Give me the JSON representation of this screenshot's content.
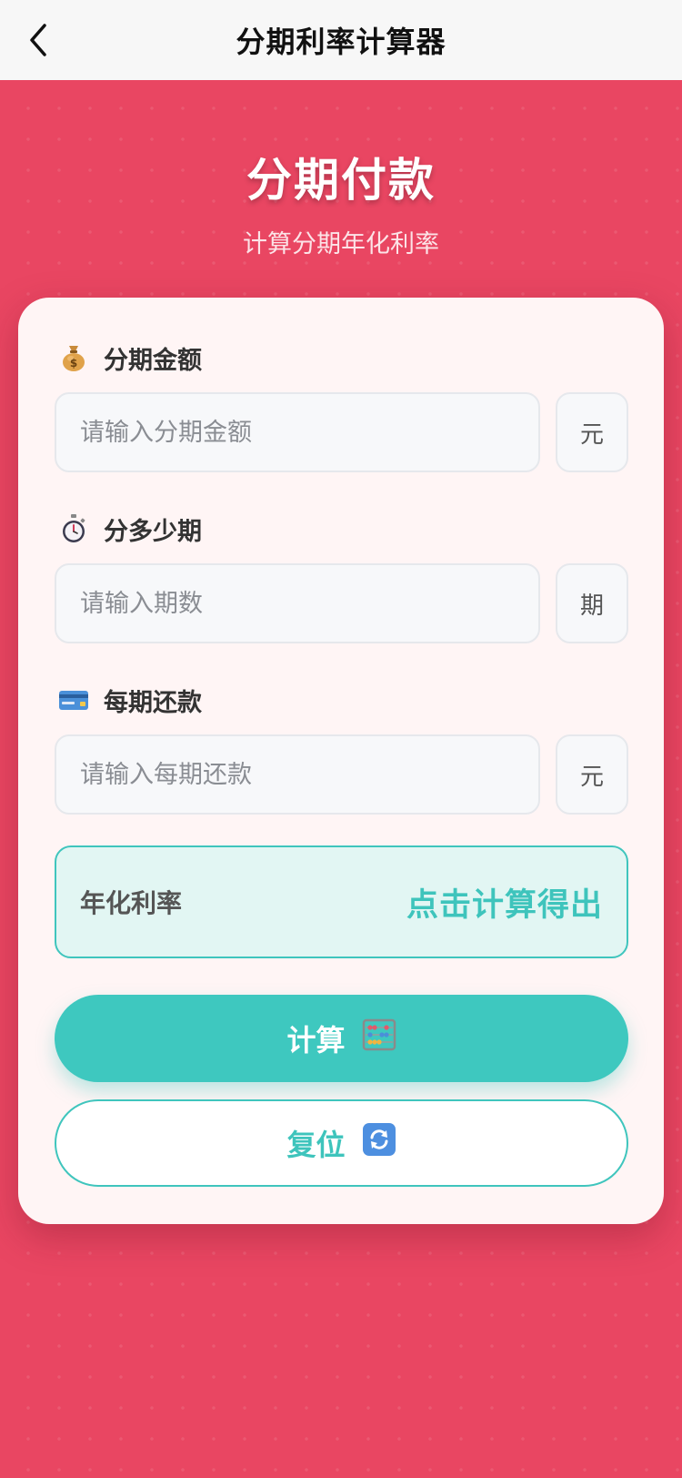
{
  "nav": {
    "title": "分期利率计算器"
  },
  "hero": {
    "title": "分期付款",
    "subtitle": "计算分期年化利率"
  },
  "form": {
    "amount": {
      "label": "分期金额",
      "placeholder": "请输入分期金额",
      "unit": "元",
      "icon": "money-bag-icon"
    },
    "periods": {
      "label": "分多少期",
      "placeholder": "请输入期数",
      "unit": "期",
      "icon": "stopwatch-icon"
    },
    "payment": {
      "label": "每期还款",
      "placeholder": "请输入每期还款",
      "unit": "元",
      "icon": "credit-card-icon"
    }
  },
  "result": {
    "label": "年化利率",
    "value": "点击计算得出"
  },
  "buttons": {
    "calculate": {
      "label": "计算",
      "icon": "abacus-icon"
    },
    "reset": {
      "label": "复位",
      "icon": "refresh-icon"
    }
  },
  "colors": {
    "brand_red": "#e94662",
    "accent_teal": "#3ec8bf",
    "card_bg": "#fff5f5"
  }
}
